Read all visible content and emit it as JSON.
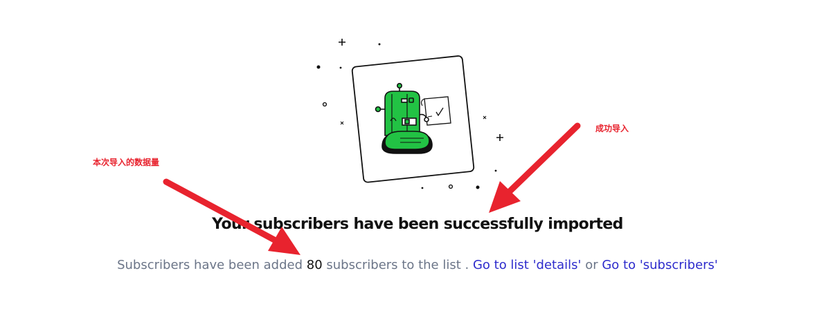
{
  "illustration": {
    "icon": "robot-document-icon",
    "accent_color": "#22c244"
  },
  "headline": {
    "text": "Your subscribers have been successfully imported"
  },
  "message": {
    "prefix": "Subscribers have been added",
    "count": "80",
    "suffix": "subscribers to the list .",
    "link_details": "Go to list 'details'",
    "or": "or",
    "link_subscribers": "Go to 'subscribers'"
  },
  "annotations": {
    "import_count_note": "本次导入的数据量",
    "success_note": "成功导入",
    "color": "#e8232e"
  },
  "colors": {
    "muted_text": "#6b7588",
    "link": "#2d2bcc"
  }
}
